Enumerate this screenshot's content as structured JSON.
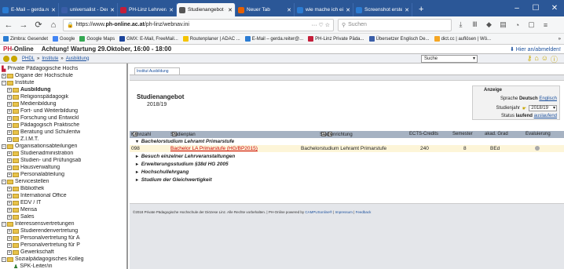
{
  "browser": {
    "tabs": [
      {
        "label": "E-Mail – gerda.reite",
        "icon_color": "#2b7cd3",
        "active": false
      },
      {
        "label": "universalist - Deuts",
        "icon_color": "#3a5ea8",
        "active": false
      },
      {
        "label": "PH-Linz Lehrveran",
        "icon_color": "#c41e3a",
        "active": false
      },
      {
        "label": "Studienangebot - P",
        "icon_color": "#555555",
        "active": true
      },
      {
        "label": "Neuer Tab",
        "icon_color": "#e66000",
        "active": false
      },
      {
        "label": "wie mache ich eine",
        "icon_color": "#2b7cd3",
        "active": false
      },
      {
        "label": "Screenshot erste",
        "icon_color": "#2b7cd3",
        "active": false
      }
    ],
    "url_prefix": "https://www.",
    "url_domain": "ph-online.ac.at",
    "url_path": "/ph-linz/webnav.ini",
    "search_placeholder": "Suchen",
    "bookmarks": [
      {
        "label": "Zimbra: Gesendet",
        "color": "#2b7cd3"
      },
      {
        "label": "Google",
        "color": "#4285f4"
      },
      {
        "label": "Google Maps",
        "color": "#34a853"
      },
      {
        "label": "GMX: E-Mail, FreeMail...",
        "color": "#1c449b"
      },
      {
        "label": "Routenplaner | ADAC ...",
        "color": "#f5c400"
      },
      {
        "label": "E-Mail – gerda.reiter@...",
        "color": "#2b7cd3"
      },
      {
        "label": "PH-Linz Private Päda...",
        "color": "#c41e3a"
      },
      {
        "label": "Übersetzer Englisch De...",
        "color": "#3a5ea8"
      },
      {
        "label": "dict.cc | auflösen | Wö...",
        "color": "#f5a623"
      }
    ]
  },
  "app": {
    "logo_prefix": "PH",
    "logo_suffix": "-Online",
    "notice": "Achtung! Wartung 29.Oktober, 16:00 - 18:00",
    "login_hint": "Hier an/abmelden!",
    "breadcrumb": [
      "PHDL",
      "Institute",
      "Ausbildung"
    ],
    "search_select": "Suche"
  },
  "sidebar": {
    "items": [
      {
        "label": "Private Pädagogische Hochs",
        "level": 0,
        "bold": false,
        "expander": ""
      },
      {
        "label": "Organe der Hochschule",
        "level": 0,
        "bold": false,
        "expander": "+"
      },
      {
        "label": "Institute",
        "level": 0,
        "bold": false,
        "expander": "−"
      },
      {
        "label": "Ausbildung",
        "level": 1,
        "bold": true,
        "expander": "+"
      },
      {
        "label": "Religionspädagogik",
        "level": 1,
        "bold": false,
        "expander": "+"
      },
      {
        "label": "Medienbildung",
        "level": 1,
        "bold": false,
        "expander": "+"
      },
      {
        "label": "Fort- und Weiterbildung",
        "level": 1,
        "bold": false,
        "expander": "+"
      },
      {
        "label": "Forschung und Entwickl",
        "level": 1,
        "bold": false,
        "expander": "+"
      },
      {
        "label": "Pädagogisch Praktische",
        "level": 1,
        "bold": false,
        "expander": "+"
      },
      {
        "label": "Beratung und Schulentw",
        "level": 1,
        "bold": false,
        "expander": "+"
      },
      {
        "label": "Z.I.M.T.",
        "level": 1,
        "bold": false,
        "expander": "+"
      },
      {
        "label": "Organisationsabteilungen",
        "level": 0,
        "bold": false,
        "expander": "−"
      },
      {
        "label": "Studienadministration",
        "level": 1,
        "bold": false,
        "expander": "+"
      },
      {
        "label": "Studien- und Prüfungsab",
        "level": 1,
        "bold": false,
        "expander": "+"
      },
      {
        "label": "Hausverwaltung",
        "level": 1,
        "bold": false,
        "expander": "+"
      },
      {
        "label": "Personalabteilung",
        "level": 1,
        "bold": false,
        "expander": "+"
      },
      {
        "label": "Servicestellen",
        "level": 0,
        "bold": false,
        "expander": "−"
      },
      {
        "label": "Bibliothek",
        "level": 1,
        "bold": false,
        "expander": "+"
      },
      {
        "label": "International Office",
        "level": 1,
        "bold": false,
        "expander": "+"
      },
      {
        "label": "EDV / IT",
        "level": 1,
        "bold": false,
        "expander": "+"
      },
      {
        "label": "Mensa",
        "level": 1,
        "bold": false,
        "expander": "+"
      },
      {
        "label": "Sales",
        "level": 1,
        "bold": false,
        "expander": "+"
      },
      {
        "label": "Interessensvertretungen",
        "level": 0,
        "bold": false,
        "expander": "−"
      },
      {
        "label": "Studierendenvertretung",
        "level": 1,
        "bold": false,
        "expander": "+"
      },
      {
        "label": "Personalvertretung für A",
        "level": 1,
        "bold": false,
        "expander": "+"
      },
      {
        "label": "Personalvertretung für P",
        "level": 1,
        "bold": false,
        "expander": "+"
      },
      {
        "label": "Gewerkschaft",
        "level": 1,
        "bold": false,
        "expander": "+"
      },
      {
        "label": "Sozialpädagogisches Kolleg",
        "level": 0,
        "bold": false,
        "expander": "−"
      },
      {
        "label": "SPK-Leiter/in",
        "level": 1,
        "bold": false,
        "expander": ""
      },
      {
        "label": "SPK-Kollegium",
        "level": 1,
        "bold": false,
        "expander": ""
      }
    ]
  },
  "main": {
    "tab": "Institut Ausbildung",
    "title": "Studienangebot",
    "year": "2018/19",
    "settings": {
      "header": "Anzeige",
      "lang_label": "Sprache",
      "lang_current": "Deutsch",
      "lang_alt": "Englisch",
      "year_label": "Studienjahr",
      "year_value": "2018/19",
      "status_label": "Status",
      "status_current": "laufend",
      "status_alt": "auslaufend"
    },
    "columns": {
      "kennzahl": "Kennzahl",
      "studienplan": "Studienplan",
      "richtung": "Studienrichtung",
      "ects": "ECTS-Credits",
      "semester": "Semester",
      "grad": "akad. Grad",
      "eval": "Evaluierung"
    },
    "group1": "Bachelorstudium Lehramt Primarstufe",
    "row": {
      "kennzahl": "098",
      "plan": "Bachelor LA Primarstufe (HG/BP2015)",
      "richtung": "Bachelorstudium Lehramt Primarstufe",
      "ects": "240",
      "semester": "8",
      "grad": "BEd"
    },
    "groups": [
      "Besuch einzelner Lehrveranstaltungen",
      "Erweiterungsstudium §38d HG 2005",
      "Hochschullehrgang",
      "Studium der Gleichwertigkeit"
    ],
    "footer_text": "©2018 Private Pädagogische Hochschule der Diözese Linz. Alle Rechte vorbehalten. | PH-Online powered by ",
    "footer_link1": "CAMPUSonline®",
    "footer_sep": " | ",
    "footer_link2": "Impressum",
    "footer_link3": "Feedback"
  }
}
